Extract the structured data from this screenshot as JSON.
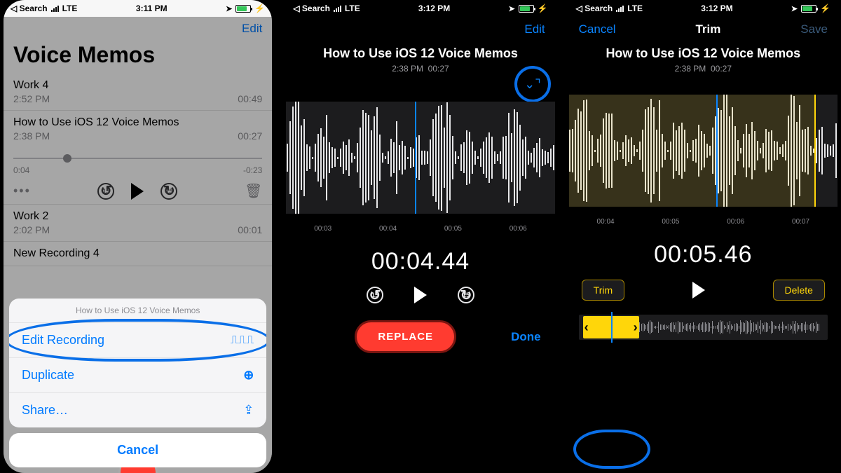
{
  "status": {
    "back": "Search",
    "carrier": "LTE",
    "time1": "3:11 PM",
    "time2": "3:12 PM",
    "time3": "3:12 PM"
  },
  "p1": {
    "edit": "Edit",
    "title": "Voice Memos",
    "memos": [
      {
        "name": "Work 4",
        "time": "2:52 PM",
        "dur": "00:49"
      },
      {
        "name": "How to Use iOS 12 Voice Memos",
        "time": "2:38 PM",
        "dur": "00:27"
      },
      {
        "name": "Work 2",
        "time": "2:02 PM",
        "dur": "00:01"
      },
      {
        "name": "New Recording 4",
        "time": "",
        "dur": ""
      }
    ],
    "player": {
      "elapsed": "0:04",
      "remain": "-0:23"
    },
    "sheet": {
      "title": "How to Use iOS 12 Voice Memos",
      "edit": "Edit Recording",
      "duplicate": "Duplicate",
      "share": "Share…",
      "cancel": "Cancel"
    }
  },
  "editor": {
    "nav_edit": "Edit",
    "title": "How to Use iOS 12 Voice Memos",
    "subtitle_time": "2:38 PM",
    "subtitle_dur": "00:27",
    "ticks2": [
      "00:03",
      "00:04",
      "00:05",
      "00:06"
    ],
    "big_time2": "00:04.44",
    "replace": "REPLACE",
    "done": "Done"
  },
  "trim": {
    "cancel": "Cancel",
    "title": "Trim",
    "save": "Save",
    "ticks": [
      "00:04",
      "00:05",
      "00:06",
      "00:07"
    ],
    "big_time": "00:05.46",
    "trim_btn": "Trim",
    "delete_btn": "Delete"
  }
}
